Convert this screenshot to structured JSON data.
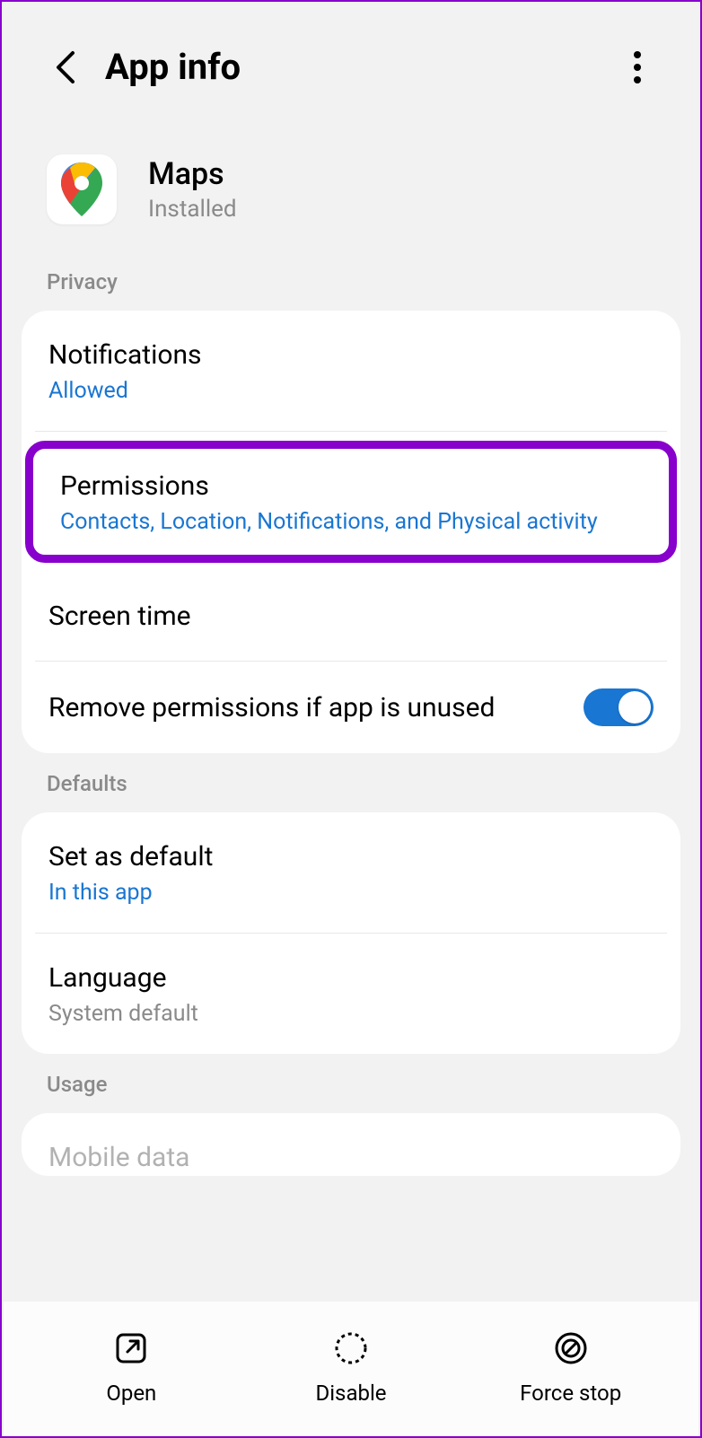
{
  "header": {
    "title": "App info"
  },
  "app": {
    "name": "Maps",
    "status": "Installed"
  },
  "sections": {
    "privacy": "Privacy",
    "defaults": "Defaults",
    "usage": "Usage"
  },
  "rows": {
    "notifications": {
      "title": "Notifications",
      "sub": "Allowed"
    },
    "permissions": {
      "title": "Permissions",
      "sub": "Contacts, Location, Notifications, and Physical activity"
    },
    "screenTime": {
      "title": "Screen time"
    },
    "removePerms": {
      "title": "Remove permissions if app is unused",
      "toggle": true
    },
    "setDefault": {
      "title": "Set as default",
      "sub": "In this app"
    },
    "language": {
      "title": "Language",
      "sub": "System default"
    },
    "mobileData": {
      "title": "Mobile data"
    }
  },
  "bottomBar": {
    "open": "Open",
    "disable": "Disable",
    "forceStop": "Force stop"
  }
}
